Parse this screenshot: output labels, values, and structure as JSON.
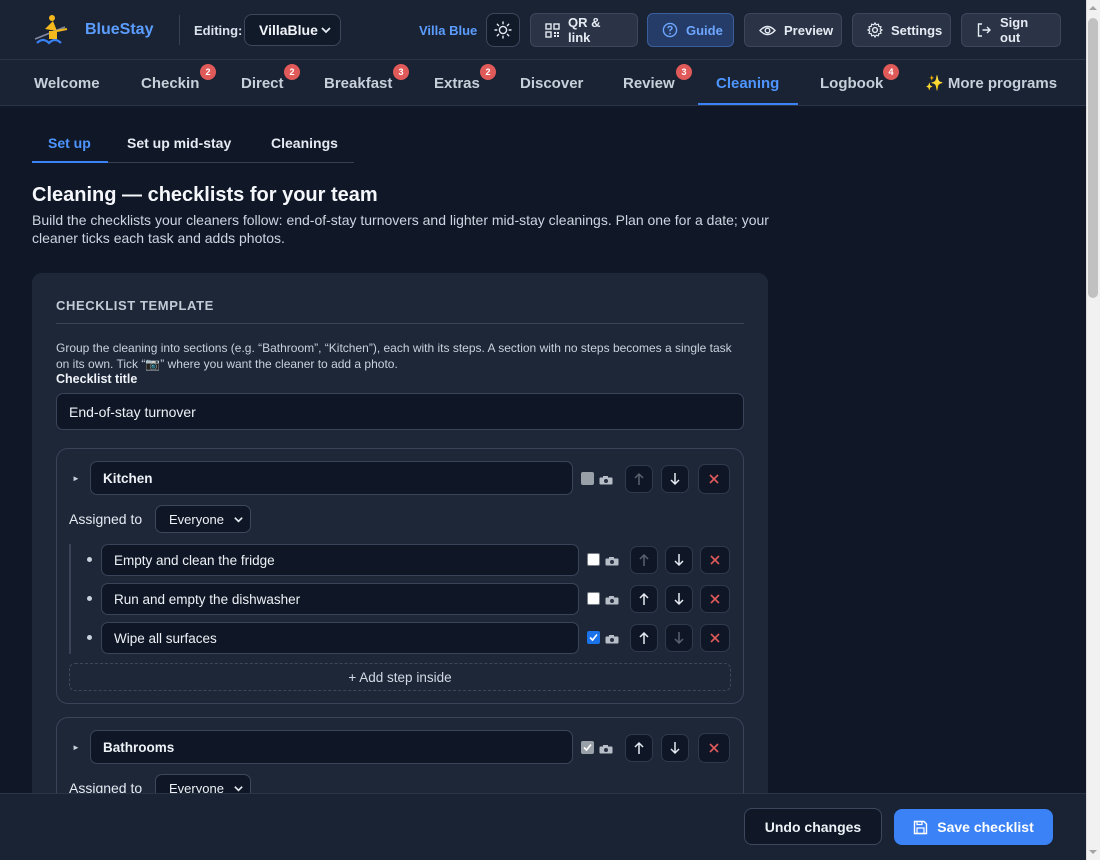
{
  "app": {
    "brand": "BlueStay"
  },
  "header": {
    "editing_label": "Editing:",
    "property_select": "VillaBlue",
    "villa_name": "Villa Blue",
    "buttons": {
      "qr": "QR & link",
      "guide": "Guide",
      "preview": "Preview",
      "settings": "Settings",
      "signout": "Sign out"
    }
  },
  "nav": {
    "tabs": [
      {
        "label": "Welcome",
        "badge": ""
      },
      {
        "label": "Checkin",
        "badge": "2"
      },
      {
        "label": "Direct",
        "badge": "2"
      },
      {
        "label": "Breakfast",
        "badge": "3"
      },
      {
        "label": "Extras",
        "badge": "2"
      },
      {
        "label": "Discover",
        "badge": ""
      },
      {
        "label": "Review",
        "badge": "3"
      },
      {
        "label": "Cleaning",
        "badge": ""
      },
      {
        "label": "Logbook",
        "badge": "4"
      },
      {
        "label": "✨ More programs",
        "badge": ""
      }
    ],
    "active": "Cleaning"
  },
  "subtabs": [
    "Set up",
    "Set up mid-stay",
    "Cleanings"
  ],
  "page": {
    "title": "Cleaning — checklists for your team",
    "description": "Build the checklists your cleaners follow: end-of-stay turnovers and lighter mid-stay cleanings. Plan one for a date; your cleaner ticks each task and adds photos."
  },
  "template": {
    "heading": "CHECKLIST TEMPLATE",
    "help": "Group the cleaning into sections (e.g. “Bathroom”, “Kitchen”), each with its steps. A section with no steps becomes a single task on its own. Tick “📷” where you want the cleaner to add a photo.",
    "title_label": "Checklist title",
    "title_value": "End-of-stay turnover",
    "assigned_label": "Assigned to",
    "add_step_label": "+ Add step inside",
    "sections": [
      {
        "name": "Kitchen",
        "photo": false,
        "assigned": "Everyone",
        "steps": [
          {
            "text": "Empty and clean the fridge",
            "photo": false
          },
          {
            "text": "Run and empty the dishwasher",
            "photo": false
          },
          {
            "text": "Wipe all surfaces",
            "photo": true
          }
        ]
      },
      {
        "name": "Bathrooms",
        "photo": true,
        "assigned": "Everyone",
        "steps": []
      }
    ]
  },
  "footer": {
    "undo": "Undo changes",
    "save": "Save checklist"
  },
  "colors": {
    "accent": "#3b82f6",
    "badge": "#e05a5a",
    "background": "#101828",
    "panel": "#1e2738",
    "danger": "#e05a5a"
  }
}
